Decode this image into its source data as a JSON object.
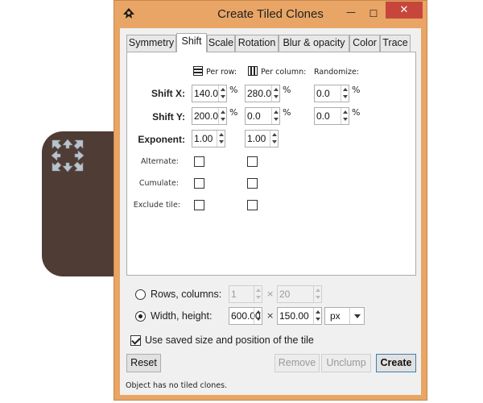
{
  "window": {
    "title": "Create Tiled Clones",
    "controls": {
      "minimize": "—",
      "maximize": "☐",
      "close": "✕"
    }
  },
  "tabs": [
    {
      "label": "Symmetry",
      "active": false
    },
    {
      "label": "Shift",
      "active": true
    },
    {
      "label": "Scale",
      "active": false
    },
    {
      "label": "Rotation",
      "active": false
    },
    {
      "label": "Blur & opacity",
      "active": false
    },
    {
      "label": "Color",
      "active": false
    },
    {
      "label": "Trace",
      "active": false
    }
  ],
  "shift_panel": {
    "headers": {
      "per_row": "Per row:",
      "per_column": "Per column:",
      "randomize": "Randomize:"
    },
    "rows": {
      "shift_x": {
        "label": "Shift X:",
        "per_row": "140.0",
        "per_column": "280.0",
        "randomize": "0.0",
        "unit": "%"
      },
      "shift_y": {
        "label": "Shift Y:",
        "per_row": "200.0",
        "per_column": "0.0",
        "randomize": "0.0",
        "unit": "%"
      },
      "exponent": {
        "label": "Exponent:",
        "per_row": "1.00",
        "per_column": "1.00"
      }
    },
    "alternate": {
      "label": "Alternate:"
    },
    "cumulate": {
      "label": "Cumulate:"
    },
    "exclude_tile": {
      "label": "Exclude tile:"
    }
  },
  "layout_options": {
    "rows_columns": {
      "label": "Rows, columns:",
      "rows": "1",
      "columns": "20",
      "selected": false
    },
    "width_height": {
      "label": "Width, height:",
      "width": "600.00",
      "height": "150.00",
      "unit": "px",
      "selected": true
    },
    "times": "×",
    "use_saved": {
      "label": "Use saved size and position of the tile",
      "checked": true
    }
  },
  "buttons": {
    "reset": "Reset",
    "remove": "Remove",
    "unclump": "Unclump",
    "create": "Create"
  },
  "status": "Object has no tiled clones.",
  "icons": {
    "canvas_handle": "move-arrows-icon",
    "app": "inkscape-icon"
  },
  "colors": {
    "title_bar": "#e8a565",
    "close_button": "#c7463c",
    "background_shape": "#4e3c35"
  }
}
